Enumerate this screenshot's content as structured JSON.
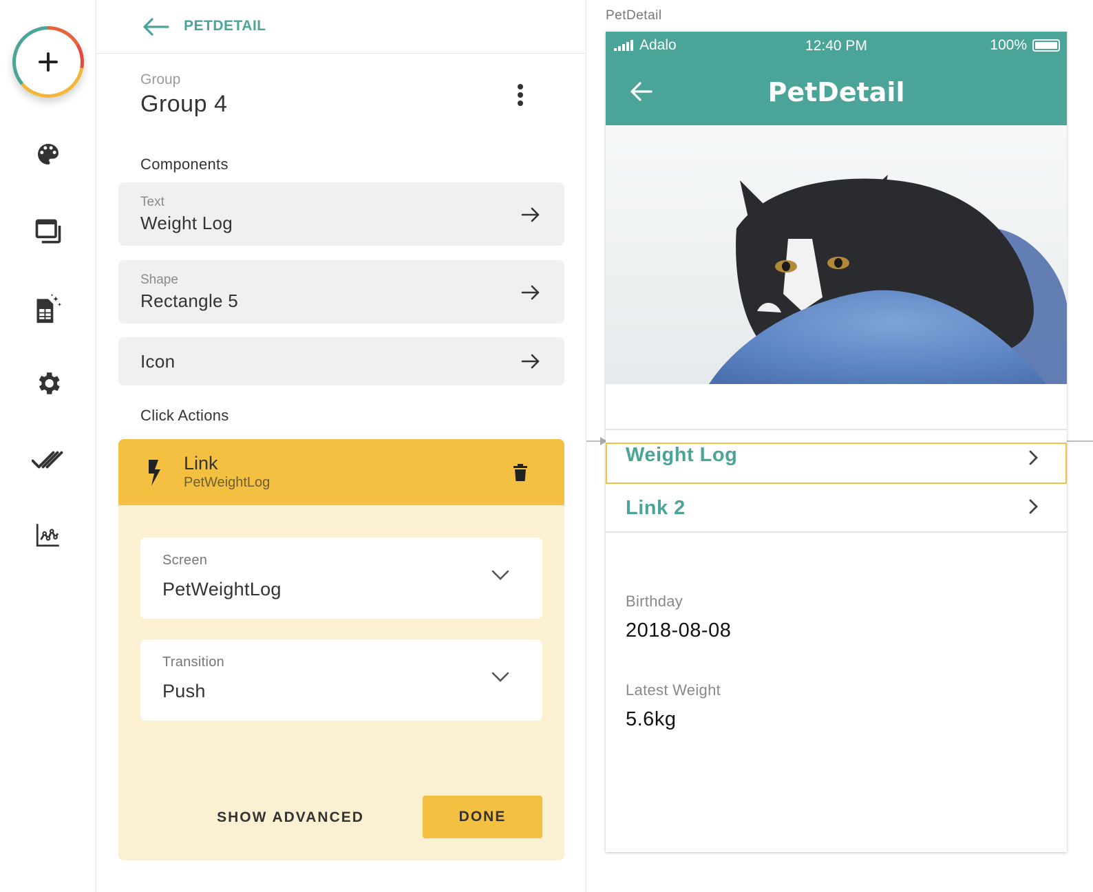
{
  "rail": {
    "icons": [
      "add-icon",
      "palette-icon",
      "screens-icon",
      "database-icon",
      "gear-icon",
      "publish-check-icon",
      "analytics-icon"
    ]
  },
  "panel": {
    "back_label": "PETDETAIL",
    "group_label": "Group",
    "group_name": "Group 4",
    "components_title": "Components",
    "components": [
      {
        "type": "Text",
        "name": "Weight Log"
      },
      {
        "type": "Shape",
        "name": "Rectangle 5"
      },
      {
        "type": "",
        "name": "Icon"
      }
    ],
    "actions_title": "Click Actions",
    "action": {
      "title": "Link",
      "subtitle": "PetWeightLog",
      "screen_label": "Screen",
      "screen_value": "PetWeightLog",
      "transition_label": "Transition",
      "transition_value": "Push",
      "show_advanced": "SHOW ADVANCED",
      "done": "DONE"
    }
  },
  "canvas": {
    "screen_label": "PetDetail",
    "status": {
      "carrier": "Adalo",
      "time": "12:40 PM",
      "battery": "100%"
    },
    "nav_title": "PetDetail",
    "links": [
      "Weight Log",
      "Link 2"
    ],
    "birthday_label": "Birthday",
    "birthday_value": "2018-08-08",
    "weight_label": "Latest Weight",
    "weight_value": "5.6kg"
  },
  "colors": {
    "accent": "#4aa598",
    "action": "#f4c042",
    "action_bg": "#fcf0d2",
    "card_bg": "#f0f0f0"
  }
}
